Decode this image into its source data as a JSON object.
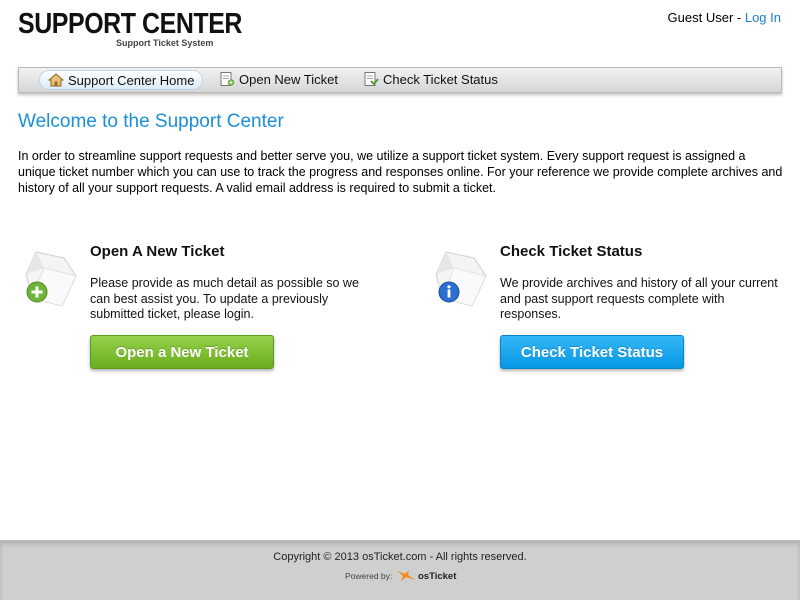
{
  "header": {
    "logo_title": "SUPPORT CENTER",
    "logo_subtitle": "Support Ticket System",
    "guest_label": "Guest User - ",
    "login_link": "Log In"
  },
  "nav": {
    "items": [
      {
        "label": "Support Center Home",
        "icon": "home-icon",
        "active": true
      },
      {
        "label": "Open New Ticket",
        "icon": "new-ticket-icon",
        "active": false
      },
      {
        "label": "Check Ticket Status",
        "icon": "ticket-status-icon",
        "active": false
      }
    ]
  },
  "main": {
    "welcome_title": "Welcome to the Support Center",
    "intro_text": "In order to streamline support requests and better serve you, we utilize a support ticket system. Every support request is assigned a unique ticket number which you can use to track the progress and responses online. For your reference we provide complete archives and history of all your support requests. A valid email address is required to submit a ticket.",
    "cards": [
      {
        "title": "Open A New Ticket",
        "text": "Please provide as much detail as possible so we can best assist you. To update a previously submitted ticket, please login.",
        "button_label": "Open a New Ticket",
        "icon": "new-ticket-plus-icon",
        "button_color": "#7dbf2e"
      },
      {
        "title": "Check Ticket Status",
        "text": "We provide archives and history of all your current and past support requests complete with responses.",
        "button_label": "Check Ticket Status",
        "icon": "ticket-info-icon",
        "button_color": "#1aa6ee"
      }
    ]
  },
  "footer": {
    "copyright": "Copyright © 2013 osTicket.com - All rights reserved.",
    "powered_by": "Powered by:",
    "powered_name": "osTicket"
  },
  "colors": {
    "accent": "#1a8fd6",
    "link": "#1a80c8",
    "footer_bg": "#cfcfcf"
  }
}
